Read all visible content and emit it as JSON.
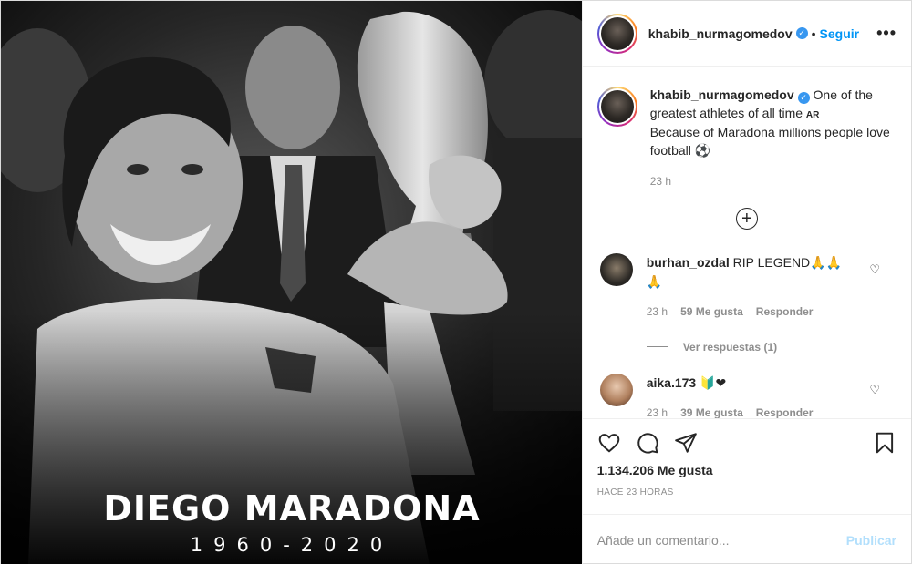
{
  "post_image": {
    "title": "DIEGO MARADONA",
    "years": "1960-2020"
  },
  "header": {
    "username": "khabib_nurmagomedov",
    "verified_icon": "verified-badge-icon",
    "separator": "•",
    "follow_label": "Seguir",
    "more_label": "•••"
  },
  "caption": {
    "username": "khabib_nurmagomedov",
    "text_line1": "One of the greatest athletes of all time",
    "flag": "AR",
    "text_line2": "Because of Maradona millions people love football",
    "emoji": "⚽",
    "time": "23 h"
  },
  "load_more_icon": "plus-circle-icon",
  "comments": [
    {
      "username": "burhan_ozdal",
      "text": "RIP LEGEND🙏🙏🙏",
      "time": "23 h",
      "likes": "59 Me gusta",
      "reply": "Responder",
      "view_replies": "Ver respuestas (1)"
    },
    {
      "username": "aika.173",
      "text": "🔰❤",
      "time": "23 h",
      "likes": "39 Me gusta",
      "reply": "Responder"
    }
  ],
  "actions": {
    "like_icon": "heart-icon",
    "comment_icon": "comment-icon",
    "share_icon": "paper-plane-icon",
    "save_icon": "bookmark-icon",
    "likes_count": "1.134.206 Me gusta",
    "posted_ago": "HACE 23 HORAS"
  },
  "add_comment": {
    "placeholder": "Añade un comentario...",
    "publish_label": "Publicar"
  },
  "colors": {
    "accent": "#0095f6",
    "publish_disabled": "#b2dffc",
    "muted": "#8e8e8e"
  }
}
